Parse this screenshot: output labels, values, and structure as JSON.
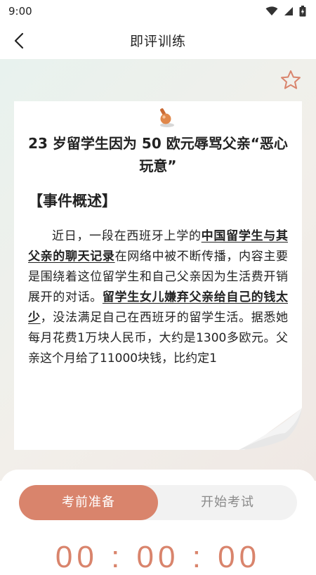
{
  "status": {
    "time": "9:00"
  },
  "header": {
    "title": "即评训练"
  },
  "article": {
    "title": "23 岁留学生因为 50 欧元辱骂父亲“恶心玩意”",
    "section_title": "【事件概述】",
    "body": [
      {
        "text": "近日，一段在西班牙上学的",
        "highlight": false
      },
      {
        "text": "中国留学生与其父亲的聊天记录",
        "highlight": true
      },
      {
        "text": "在网络中被不断传播，内容主要是围绕着这位留学生和自己父亲因为生活费开销展开的对话。",
        "highlight": false
      },
      {
        "text": "留学生女儿嫌弃父亲给自己的钱太少",
        "highlight": true
      },
      {
        "text": "，没法满足自己在西班牙的留学生活。据悉她每月花费1万块人民币，大约是1300多欧元。父亲这个月给了11000块钱，比约定1",
        "highlight": false
      }
    ]
  },
  "tabs": {
    "prepare": "考前准备",
    "start": "开始考试"
  },
  "timer": "00 : 00 : 00",
  "colors": {
    "accent": "#d9846c",
    "pin": "#e0874a"
  },
  "icons": [
    "back-icon",
    "star-icon",
    "pushpin-icon",
    "wifi-icon",
    "signal-icon",
    "battery-icon"
  ]
}
